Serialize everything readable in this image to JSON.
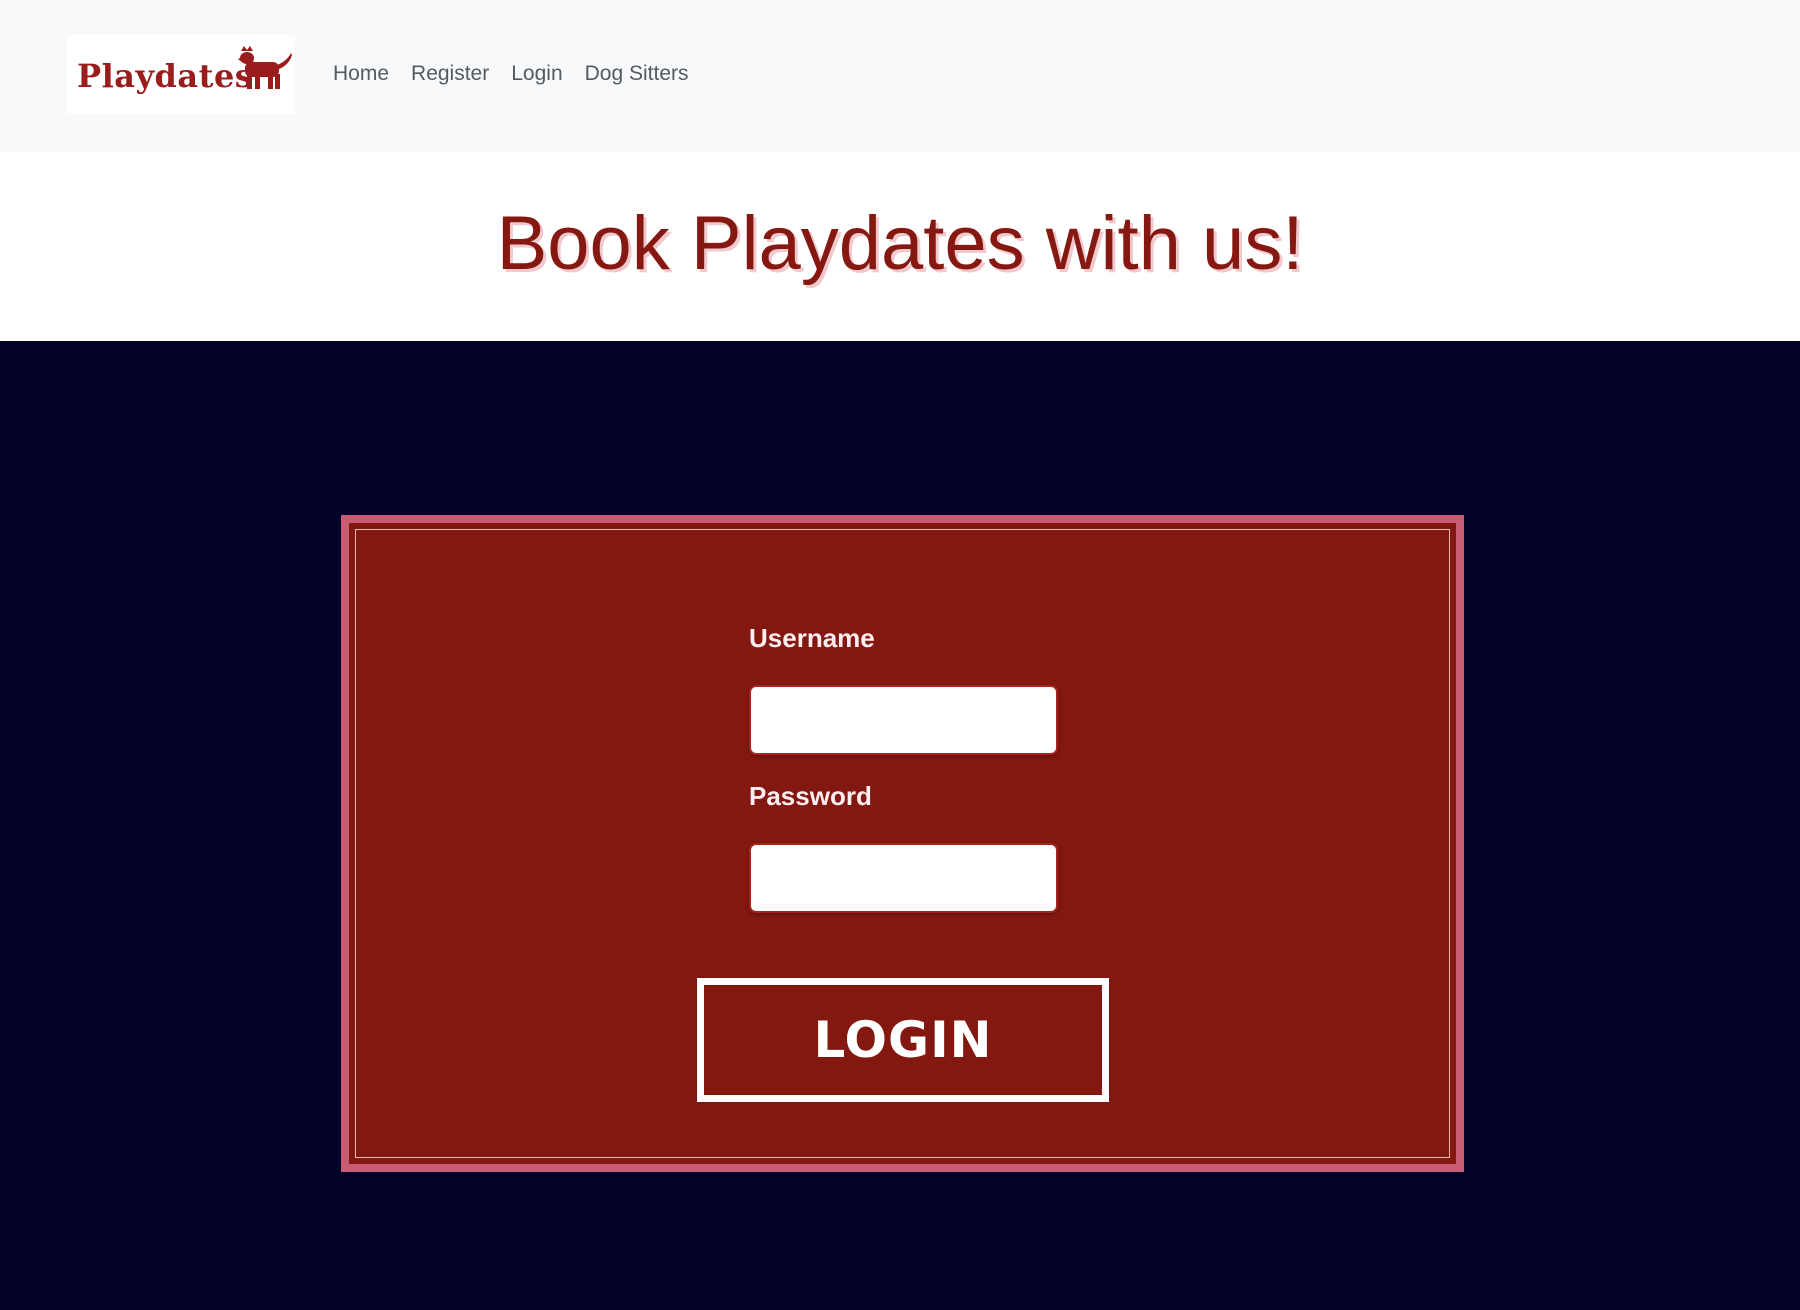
{
  "navbar": {
    "brand": "Playdates",
    "links": [
      {
        "label": "Home"
      },
      {
        "label": "Register"
      },
      {
        "label": "Login"
      },
      {
        "label": "Dog Sitters"
      }
    ]
  },
  "hero": {
    "title": "Book Playdates with us!"
  },
  "login_form": {
    "username_label": "Username",
    "username_value": "",
    "password_label": "Password",
    "password_value": "",
    "submit_label": "LOGIN"
  },
  "colors": {
    "brand_red": "#831810",
    "navy_background": "#020228",
    "card_border_pink": "#c75c72",
    "navbar_background": "#f8f9fa"
  },
  "icons": {
    "logo_dog": "dog-icon"
  }
}
